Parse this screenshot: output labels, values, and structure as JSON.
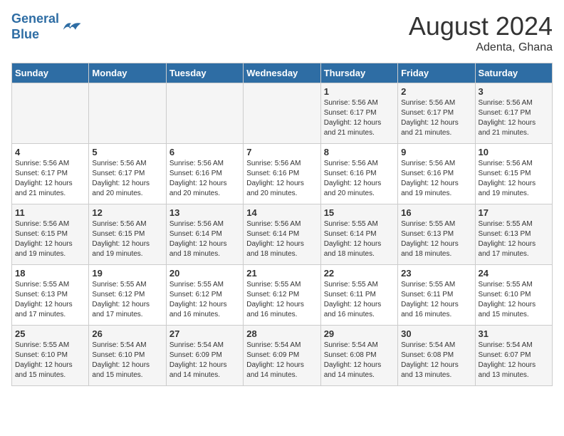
{
  "logo": {
    "line1": "General",
    "line2": "Blue"
  },
  "title": "August 2024",
  "subtitle": "Adenta, Ghana",
  "days_of_week": [
    "Sunday",
    "Monday",
    "Tuesday",
    "Wednesday",
    "Thursday",
    "Friday",
    "Saturday"
  ],
  "weeks": [
    [
      {
        "day": "",
        "info": ""
      },
      {
        "day": "",
        "info": ""
      },
      {
        "day": "",
        "info": ""
      },
      {
        "day": "",
        "info": ""
      },
      {
        "day": "1",
        "info": "Sunrise: 5:56 AM\nSunset: 6:17 PM\nDaylight: 12 hours\nand 21 minutes."
      },
      {
        "day": "2",
        "info": "Sunrise: 5:56 AM\nSunset: 6:17 PM\nDaylight: 12 hours\nand 21 minutes."
      },
      {
        "day": "3",
        "info": "Sunrise: 5:56 AM\nSunset: 6:17 PM\nDaylight: 12 hours\nand 21 minutes."
      }
    ],
    [
      {
        "day": "4",
        "info": "Sunrise: 5:56 AM\nSunset: 6:17 PM\nDaylight: 12 hours\nand 21 minutes."
      },
      {
        "day": "5",
        "info": "Sunrise: 5:56 AM\nSunset: 6:17 PM\nDaylight: 12 hours\nand 20 minutes."
      },
      {
        "day": "6",
        "info": "Sunrise: 5:56 AM\nSunset: 6:16 PM\nDaylight: 12 hours\nand 20 minutes."
      },
      {
        "day": "7",
        "info": "Sunrise: 5:56 AM\nSunset: 6:16 PM\nDaylight: 12 hours\nand 20 minutes."
      },
      {
        "day": "8",
        "info": "Sunrise: 5:56 AM\nSunset: 6:16 PM\nDaylight: 12 hours\nand 20 minutes."
      },
      {
        "day": "9",
        "info": "Sunrise: 5:56 AM\nSunset: 6:16 PM\nDaylight: 12 hours\nand 19 minutes."
      },
      {
        "day": "10",
        "info": "Sunrise: 5:56 AM\nSunset: 6:15 PM\nDaylight: 12 hours\nand 19 minutes."
      }
    ],
    [
      {
        "day": "11",
        "info": "Sunrise: 5:56 AM\nSunset: 6:15 PM\nDaylight: 12 hours\nand 19 minutes."
      },
      {
        "day": "12",
        "info": "Sunrise: 5:56 AM\nSunset: 6:15 PM\nDaylight: 12 hours\nand 19 minutes."
      },
      {
        "day": "13",
        "info": "Sunrise: 5:56 AM\nSunset: 6:14 PM\nDaylight: 12 hours\nand 18 minutes."
      },
      {
        "day": "14",
        "info": "Sunrise: 5:56 AM\nSunset: 6:14 PM\nDaylight: 12 hours\nand 18 minutes."
      },
      {
        "day": "15",
        "info": "Sunrise: 5:55 AM\nSunset: 6:14 PM\nDaylight: 12 hours\nand 18 minutes."
      },
      {
        "day": "16",
        "info": "Sunrise: 5:55 AM\nSunset: 6:13 PM\nDaylight: 12 hours\nand 18 minutes."
      },
      {
        "day": "17",
        "info": "Sunrise: 5:55 AM\nSunset: 6:13 PM\nDaylight: 12 hours\nand 17 minutes."
      }
    ],
    [
      {
        "day": "18",
        "info": "Sunrise: 5:55 AM\nSunset: 6:13 PM\nDaylight: 12 hours\nand 17 minutes."
      },
      {
        "day": "19",
        "info": "Sunrise: 5:55 AM\nSunset: 6:12 PM\nDaylight: 12 hours\nand 17 minutes."
      },
      {
        "day": "20",
        "info": "Sunrise: 5:55 AM\nSunset: 6:12 PM\nDaylight: 12 hours\nand 16 minutes."
      },
      {
        "day": "21",
        "info": "Sunrise: 5:55 AM\nSunset: 6:12 PM\nDaylight: 12 hours\nand 16 minutes."
      },
      {
        "day": "22",
        "info": "Sunrise: 5:55 AM\nSunset: 6:11 PM\nDaylight: 12 hours\nand 16 minutes."
      },
      {
        "day": "23",
        "info": "Sunrise: 5:55 AM\nSunset: 6:11 PM\nDaylight: 12 hours\nand 16 minutes."
      },
      {
        "day": "24",
        "info": "Sunrise: 5:55 AM\nSunset: 6:10 PM\nDaylight: 12 hours\nand 15 minutes."
      }
    ],
    [
      {
        "day": "25",
        "info": "Sunrise: 5:55 AM\nSunset: 6:10 PM\nDaylight: 12 hours\nand 15 minutes."
      },
      {
        "day": "26",
        "info": "Sunrise: 5:54 AM\nSunset: 6:10 PM\nDaylight: 12 hours\nand 15 minutes."
      },
      {
        "day": "27",
        "info": "Sunrise: 5:54 AM\nSunset: 6:09 PM\nDaylight: 12 hours\nand 14 minutes."
      },
      {
        "day": "28",
        "info": "Sunrise: 5:54 AM\nSunset: 6:09 PM\nDaylight: 12 hours\nand 14 minutes."
      },
      {
        "day": "29",
        "info": "Sunrise: 5:54 AM\nSunset: 6:08 PM\nDaylight: 12 hours\nand 14 minutes."
      },
      {
        "day": "30",
        "info": "Sunrise: 5:54 AM\nSunset: 6:08 PM\nDaylight: 12 hours\nand 13 minutes."
      },
      {
        "day": "31",
        "info": "Sunrise: 5:54 AM\nSunset: 6:07 PM\nDaylight: 12 hours\nand 13 minutes."
      }
    ]
  ]
}
